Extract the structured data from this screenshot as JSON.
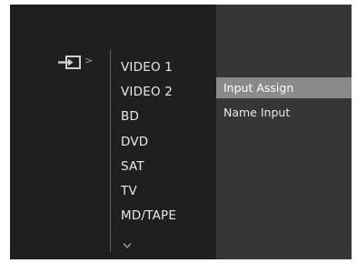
{
  "menu": {
    "source_icon": "input-source-icon",
    "inputs": [
      "VIDEO 1",
      "VIDEO 2",
      "BD",
      "DVD",
      "SAT",
      "TV",
      "MD/TAPE"
    ]
  },
  "submenu": {
    "items": [
      "Input Assign",
      "Name Input"
    ],
    "selected": "Input Assign"
  },
  "colors": {
    "background": "#1f1f1f",
    "panel": "#363636",
    "highlight": "#8a8a8a",
    "text": "#e8e8e8"
  }
}
